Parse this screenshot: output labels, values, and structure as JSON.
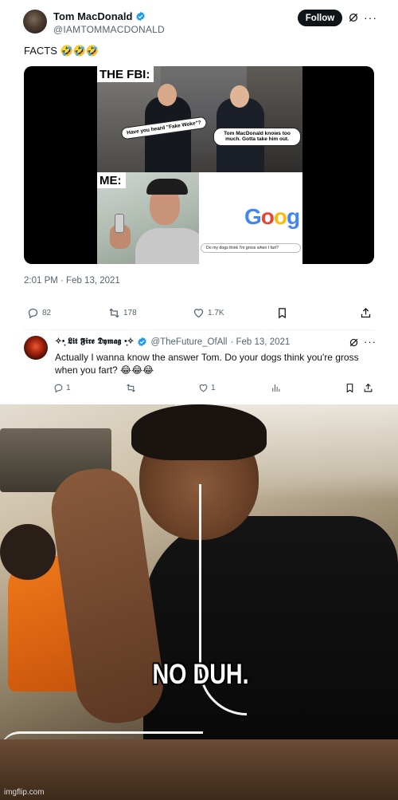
{
  "tweet": {
    "display_name": "Tom MacDonald",
    "handle": "@IAMTOMMACDONALD",
    "follow_label": "Follow",
    "more_label": "···",
    "text": "FACTS 🤣🤣🤣",
    "timestamp": "2:01 PM · Feb 13, 2021",
    "metrics": {
      "replies": "82",
      "retweets": "178",
      "likes": "1.7K"
    },
    "media": {
      "fbi_label": "THE FBI:",
      "bubble_1": "Have you heard \"Fake Woke\"?",
      "bubble_2": "Tom MacDonald knows too much. Gotta take him out.",
      "me_label": "ME:",
      "google_letters": [
        "G",
        "o",
        "o",
        "g"
      ],
      "search_query": "Do my dogs think I'm gross when I fart?"
    }
  },
  "reply": {
    "display_name": "✧•̩̩͙ 𝕷𝖎𝖙 𝕱𝖎𝖗𝖊 𝕯𝖞𝖒𝖆𝖌 •̩̩͙✧",
    "handle": "@TheFuture_OfAll",
    "date": "· Feb 13, 2021",
    "more_label": "···",
    "text": "Actually I wanna know the answer Tom. Do your dogs think you're gross when you fart? 😂😂😂",
    "metrics": {
      "replies": "1",
      "likes": "1"
    }
  },
  "meme": {
    "caption": "NO DUH.",
    "watermark": "imgflip.com"
  },
  "colors": {
    "verified": "#1d9bf0",
    "text_secondary": "#536471"
  }
}
